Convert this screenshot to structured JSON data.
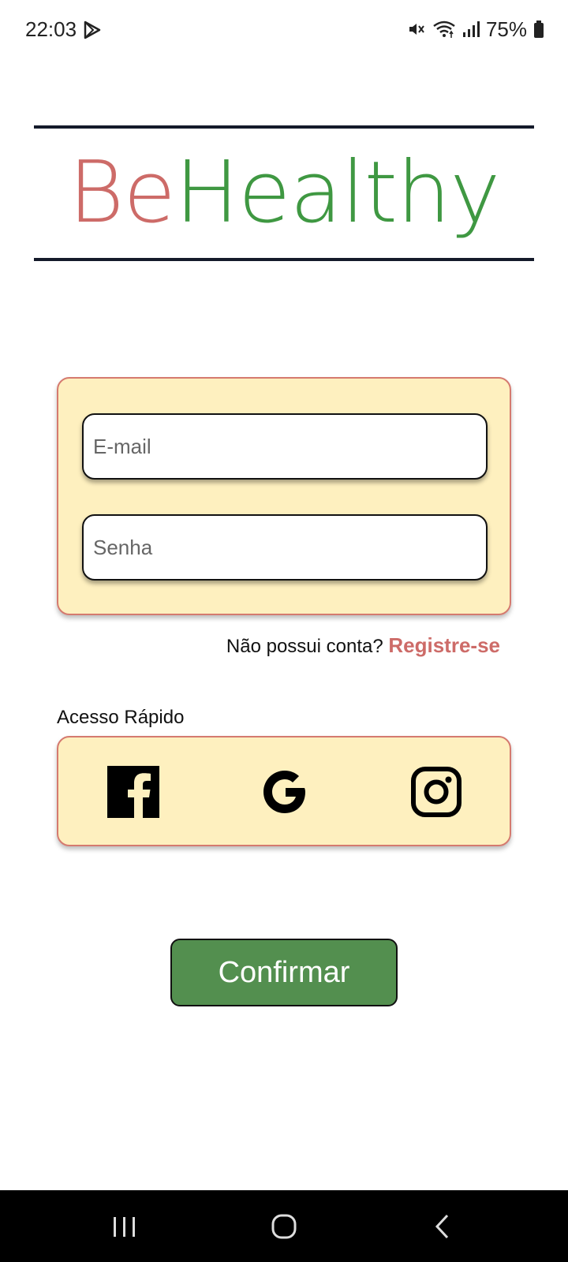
{
  "status_bar": {
    "time": "22:03",
    "battery": "75%",
    "icons": [
      "play-store-icon",
      "mute-icon",
      "wifi-icon",
      "signal-icon",
      "battery-icon"
    ]
  },
  "logo": {
    "part1": "Be",
    "part2": "Healthy",
    "colors": {
      "be": "#cd6b68",
      "healthy": "#3f9842"
    }
  },
  "login": {
    "email_placeholder": "E-mail",
    "email_value": "",
    "password_placeholder": "Senha",
    "password_value": ""
  },
  "register": {
    "prompt": "Não possui conta?",
    "link": "Registre-se"
  },
  "quick_access": {
    "label": "Acesso Rápido",
    "providers": [
      "facebook-icon",
      "google-icon",
      "instagram-icon"
    ]
  },
  "confirm_label": "Confirmar",
  "colors": {
    "card_background": "#fef0bf",
    "card_border": "#d57a6f",
    "confirm_button": "#538f4f",
    "accent": "#cd6b68"
  },
  "nav_bar": {
    "buttons": [
      "recent-apps-icon",
      "home-icon",
      "back-icon"
    ]
  }
}
